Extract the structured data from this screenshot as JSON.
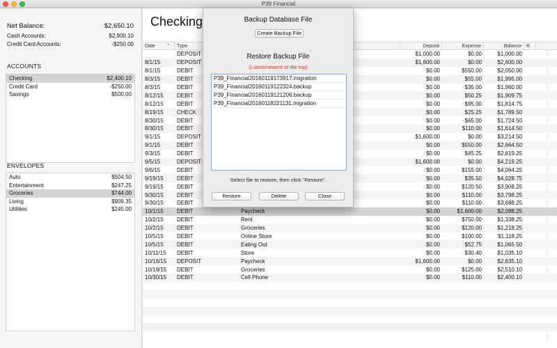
{
  "window": {
    "title": "P39 Financial"
  },
  "summary": {
    "net_label": "Net Balance:",
    "net_value": "$2,650.10",
    "cash_label": "Cash Accounts:",
    "cash_value": "$2,900.10",
    "credit_label": "Credit Card Accounts:",
    "credit_value": "-$250.00"
  },
  "accounts": {
    "title": "ACCOUNTS",
    "items": [
      {
        "name": "Checking",
        "value": "$2,400.10"
      },
      {
        "name": "Credit Card",
        "value": "-$250.00"
      },
      {
        "name": "Savings",
        "value": "$500.00"
      }
    ]
  },
  "envelopes": {
    "title": "ENVELOPES",
    "items": [
      {
        "name": "Auto",
        "value": "$504.50"
      },
      {
        "name": "Entertainment",
        "value": "$247.25"
      },
      {
        "name": "Groceries",
        "value": "$744.00"
      },
      {
        "name": "Living",
        "value": "$909.35"
      },
      {
        "name": "Utilities",
        "value": "$245.00"
      }
    ]
  },
  "main": {
    "title": "Checking",
    "columns": {
      "date": "Date",
      "type": "Type",
      "description": "",
      "deposit": "Deposit",
      "expense": "Expense",
      "balance": "Balance",
      "r": "R"
    },
    "rows": [
      {
        "date": "",
        "type": "DEPOSIT",
        "desc": "",
        "deposit": "$1,000.00",
        "expense": "$0.00",
        "balance": "$1,000.00"
      },
      {
        "date": "8/1/15",
        "type": "DEPOSIT",
        "desc": "",
        "deposit": "$1,600.00",
        "expense": "$0.00",
        "balance": "$2,600.00"
      },
      {
        "date": "8/1/15",
        "type": "DEBIT",
        "desc": "",
        "deposit": "$0.00",
        "expense": "$550.00",
        "balance": "$2,050.00"
      },
      {
        "date": "8/3/15",
        "type": "DEBIT",
        "desc": "",
        "deposit": "$0.00",
        "expense": "$55.00",
        "balance": "$1,995.00"
      },
      {
        "date": "8/3/15",
        "type": "DEBIT",
        "desc": "",
        "deposit": "$0.00",
        "expense": "$35.00",
        "balance": "$1,960.00"
      },
      {
        "date": "8/12/15",
        "type": "DEBIT",
        "desc": "",
        "deposit": "$0.00",
        "expense": "$50.25",
        "balance": "$1,909.75"
      },
      {
        "date": "8/12/15",
        "type": "DEBIT",
        "desc": "",
        "deposit": "$0.00",
        "expense": "$95.00",
        "balance": "$1,814.75"
      },
      {
        "date": "8/19/15",
        "type": "CHECK",
        "desc": "",
        "deposit": "$0.00",
        "expense": "$25.25",
        "balance": "$1,789.50"
      },
      {
        "date": "8/30/15",
        "type": "DEBIT",
        "desc": "",
        "deposit": "$0.00",
        "expense": "$65.00",
        "balance": "$1,724.50"
      },
      {
        "date": "8/30/15",
        "type": "DEBIT",
        "desc": "",
        "deposit": "$0.00",
        "expense": "$110.00",
        "balance": "$1,614.50"
      },
      {
        "date": "9/1/15",
        "type": "DEPOSIT",
        "desc": "",
        "deposit": "$1,600.00",
        "expense": "$0.00",
        "balance": "$3,214.50"
      },
      {
        "date": "9/1/15",
        "type": "DEBIT",
        "desc": "",
        "deposit": "$0.00",
        "expense": "$550.00",
        "balance": "$2,664.50"
      },
      {
        "date": "9/3/15",
        "type": "DEBIT",
        "desc": "",
        "deposit": "$0.00",
        "expense": "$45.25",
        "balance": "$2,619.25"
      },
      {
        "date": "9/5/15",
        "type": "DEPOSIT",
        "desc": "",
        "deposit": "$1,600.00",
        "expense": "$0.00",
        "balance": "$4,219.25"
      },
      {
        "date": "9/6/15",
        "type": "DEBIT",
        "desc": "",
        "deposit": "$0.00",
        "expense": "$155.00",
        "balance": "$4,064.25"
      },
      {
        "date": "9/19/15",
        "type": "DEBIT",
        "desc": "",
        "deposit": "$0.00",
        "expense": "$35.50",
        "balance": "$4,028.75"
      },
      {
        "date": "9/19/15",
        "type": "DEBIT",
        "desc": "",
        "deposit": "$0.00",
        "expense": "$120.50",
        "balance": "$3,908.25"
      },
      {
        "date": "9/30/15",
        "type": "DEBIT",
        "desc": "",
        "deposit": "$0.00",
        "expense": "$110.00",
        "balance": "$3,798.25"
      },
      {
        "date": "9/30/15",
        "type": "DEBIT",
        "desc": "",
        "deposit": "$0.00",
        "expense": "$110.00",
        "balance": "$3,688.25"
      },
      {
        "date": "10/1/15",
        "type": "DEBIT",
        "desc": "Paycheck",
        "deposit": "$0.00",
        "expense": "$1,600.00",
        "balance": "$2,088.25"
      },
      {
        "date": "10/2/15",
        "type": "DEBIT",
        "desc": "Rent",
        "deposit": "$0.00",
        "expense": "$750.00",
        "balance": "$1,338.25"
      },
      {
        "date": "10/2/15",
        "type": "DEBIT",
        "desc": "Groceries",
        "deposit": "$0.00",
        "expense": "$120.00",
        "balance": "$1,218.25"
      },
      {
        "date": "10/5/15",
        "type": "DEBIT",
        "desc": "Online Store",
        "deposit": "$0.00",
        "expense": "$100.00",
        "balance": "$1,118.25"
      },
      {
        "date": "10/5/15",
        "type": "DEBIT",
        "desc": "Eating Out",
        "deposit": "$0.00",
        "expense": "$52.75",
        "balance": "$1,065.50"
      },
      {
        "date": "10/11/15",
        "type": "DEBIT",
        "desc": "Store",
        "deposit": "$0.00",
        "expense": "$30.40",
        "balance": "$1,035.10"
      },
      {
        "date": "10/16/15",
        "type": "DEPOSIT",
        "desc": "Paycheck",
        "deposit": "$1,600.00",
        "expense": "$0.00",
        "balance": "$2,635.10"
      },
      {
        "date": "10/19/15",
        "type": "DEBIT",
        "desc": "Groceries",
        "deposit": "$0.00",
        "expense": "$125.00",
        "balance": "$2,510.10"
      },
      {
        "date": "10/30/15",
        "type": "DEBIT",
        "desc": "Cell Phone",
        "deposit": "$0.00",
        "expense": "$110.00",
        "balance": "$2,400.10"
      }
    ]
  },
  "modal": {
    "backup_title": "Backup Database File",
    "create_button": "Create Backup File",
    "restore_title": "Restore Backup File",
    "restore_subtitle": "(Latest/newest at the top)",
    "files": [
      "P39_Financial20160119173917.migration",
      "P39_Financial20160119122324.backup",
      "P39_Financial20160119121206.backup",
      "P39_Financial20160118221131.migration"
    ],
    "hint": "Select file to restore, then click \"Restore\".",
    "restore_button": "Restore",
    "delete_button": "Delete",
    "close_button": "Close"
  }
}
